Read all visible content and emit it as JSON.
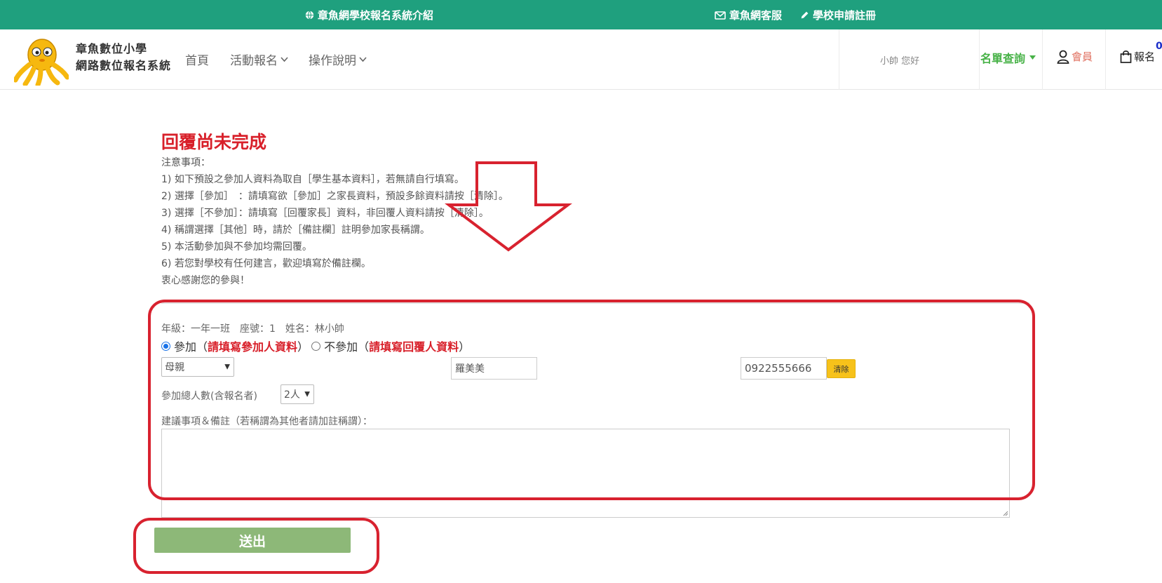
{
  "topbar": {
    "intro": "章魚網學校報名系統介紹",
    "service": "章魚網客服",
    "register": "學校申請註冊"
  },
  "brand": {
    "line1": "章魚數位小學",
    "line2": "網路數位報名系統"
  },
  "nav": {
    "home": "首頁",
    "activity": "活動報名",
    "guide": "操作說明",
    "greeting": "小帥 您好",
    "roster": "名單查詢",
    "member": "會員",
    "cart": "報名",
    "cart_count": "0"
  },
  "page": {
    "title": "回覆尚未完成",
    "notes": [
      "注意事項：",
      "1) 如下預設之參加人資料為取自［學生基本資料］，若無請自行填寫。",
      "2) 選擇［參加］　：請填寫欲［參加］之家長資料，預設多餘資料請按［清除］。",
      "3) 選擇［不參加］：請填寫［回覆家長］資料，非回覆人資料請按［清除］。",
      "4) 稱謂選擇［其他］時，請於［備註欄］註明參加家長稱謂。",
      "5) 本活動參加與不參加均需回覆。",
      "6) 若您對學校有任何建言，歡迎填寫於備註欄。",
      "衷心感謝您的參與！"
    ]
  },
  "form": {
    "student_info": "年級：一年一班　座號：1　姓名：林小帥",
    "attend_label": "參加",
    "attend_hint": "請填寫參加人資料",
    "not_attend_label": "不參加",
    "not_attend_hint": "請填寫回覆人資料",
    "paren_open": "（",
    "paren_close": "）",
    "attend_selected": true,
    "relation_value": "母親",
    "name_value": "羅美美",
    "phone_value": "0922555666",
    "clear_label": "清除",
    "count_label": "參加總人數(含報名者)",
    "count_value": "2人",
    "remark_label": "建議事項＆備註（若稱謂為其他者請加註稱謂）：",
    "remark_value": "",
    "submit_label": "送出"
  },
  "colors": {
    "topbar_bg": "#1fa07e",
    "title_red": "#d8202a",
    "roster_green": "#47b247",
    "submit_green": "#8db878",
    "clear_yellow": "#f7c21a",
    "annotation_red": "#d8222f"
  }
}
